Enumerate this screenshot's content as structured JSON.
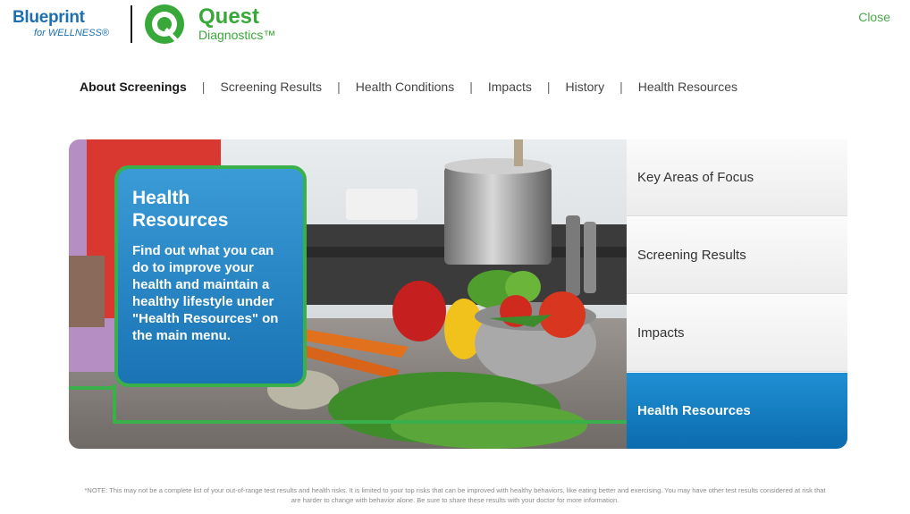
{
  "header": {
    "blueprint_line1": "Blueprint",
    "blueprint_line2": "for WELLNESS®",
    "quest_name": "Quest",
    "quest_sub": "Diagnostics™",
    "close_label": "Close"
  },
  "nav": {
    "items": [
      {
        "label": "About Screenings",
        "active": true
      },
      {
        "label": "Screening Results",
        "active": false
      },
      {
        "label": "Health Conditions",
        "active": false
      },
      {
        "label": "Impacts",
        "active": false
      },
      {
        "label": "History",
        "active": false
      },
      {
        "label": "Health Resources",
        "active": false
      }
    ],
    "separator": "|"
  },
  "hero": {
    "title": "Health Resources",
    "text": "Find out what you can do to improve your health and maintain a healthy lifestyle under \"Health Resources\" on the main menu."
  },
  "side_menu": {
    "items": [
      {
        "label": "Key Areas of Focus",
        "active": false
      },
      {
        "label": "Screening Results",
        "active": false
      },
      {
        "label": "Impacts",
        "active": false
      },
      {
        "label": "Health Resources",
        "active": true
      }
    ]
  },
  "footnote": "*NOTE: This may not be a complete list of your out-of-range test results and health risks. It is limited to your top risks that can be improved with healthy behaviors, like eating better and exercising. You may have other test results considered at risk that are harder to change with behavior alone. Be sure to share these results with your doctor for more information.",
  "colors": {
    "brand_green": "#39b04a",
    "brand_blue": "#1d6fb0",
    "active_tab": "#0b6cae"
  }
}
